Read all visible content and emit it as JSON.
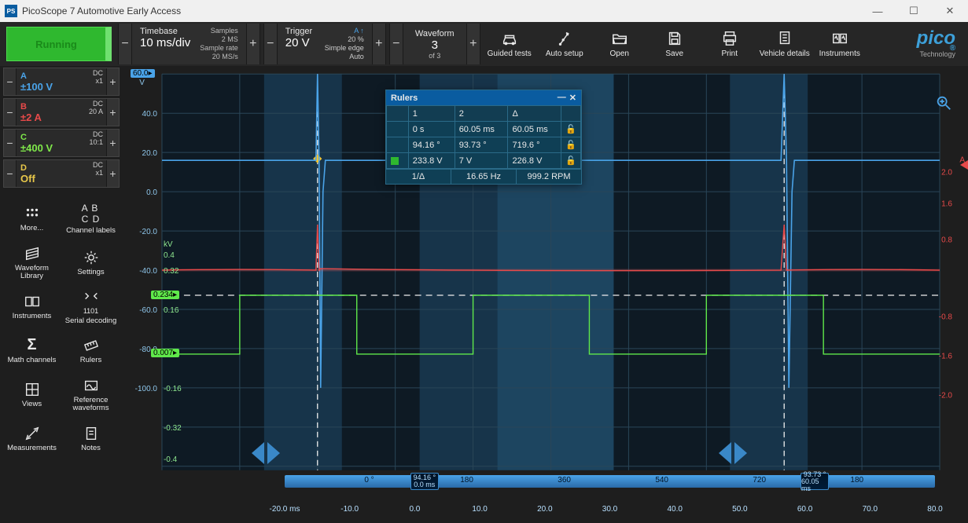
{
  "window": {
    "title": "PicoScope 7 Automotive Early Access"
  },
  "run_button": "Running",
  "timebase": {
    "label": "Timebase",
    "value": "10 ms/div",
    "samples_l": "Samples",
    "samples_v": "2 MS",
    "rate_l": "Sample rate",
    "rate_v": "20 MS/s"
  },
  "trigger": {
    "label": "Trigger",
    "value": "20 V",
    "ch": "A ↑",
    "pct": "20 %",
    "mode": "Simple edge",
    "auto": "Auto"
  },
  "waveform": {
    "label": "Waveform",
    "num": "3",
    "of": "of 3"
  },
  "topicons": {
    "guided": "Guided tests",
    "auto": "Auto setup",
    "open": "Open",
    "save": "Save",
    "print": "Print",
    "vehicle": "Vehicle details",
    "instr": "Instruments"
  },
  "logo": {
    "brand": "pico",
    "sub": "Technology"
  },
  "channels": {
    "A": {
      "label": "A",
      "range": "±100 V",
      "coupling": "DC",
      "probe": "x1"
    },
    "B": {
      "label": "B",
      "range": "±2 A",
      "coupling": "DC",
      "probe": "20 A"
    },
    "C": {
      "label": "C",
      "range": "±400 V",
      "coupling": "DC",
      "probe": "10:1"
    },
    "D": {
      "label": "D",
      "range": "Off",
      "coupling": "DC",
      "probe": "x1"
    }
  },
  "tools": {
    "more": "More...",
    "chlabels": "Channel labels",
    "wflib": "Waveform Library",
    "settings": "Settings",
    "instruments": "Instruments",
    "serial": "Serial decoding",
    "math": "Math channels",
    "rulers": "Rulers",
    "views": "Views",
    "refwf": "Reference waveforms",
    "meas": "Measurements",
    "notes": "Notes"
  },
  "rulers_panel": {
    "title": "Rulers",
    "cols": {
      "c1": "1",
      "c2": "2",
      "cd": "Δ"
    },
    "time": {
      "c1": "0 s",
      "c2": "60.05 ms",
      "cd": "60.05 ms"
    },
    "phase": {
      "c1": "94.16 °",
      "c2": "93.73 °",
      "cd": "719.6 °"
    },
    "volt": {
      "c1": "233.8 V",
      "c2": "7 V",
      "cd": "226.8 V"
    },
    "freq_l": "1/Δ",
    "freq": "16.65 Hz",
    "rpm": "999.2 RPM"
  },
  "ruler_markers": {
    "m1_deg": "94.16 °",
    "m1_t": "0.0 ms",
    "m2_deg": "93.73 °",
    "m2_t": "60.05 ms"
  },
  "rotation_ticks": [
    "0 °",
    "180",
    "360",
    "540",
    "720",
    "180"
  ],
  "xaxis_ticks": [
    "-20.0 ms",
    "-10.0",
    "0.0",
    "10.0",
    "20.0",
    "30.0",
    "40.0",
    "50.0",
    "60.0",
    "70.0",
    "80.0"
  ],
  "yA_ticks": [
    "60.0",
    "40.0",
    "20.0",
    "0.0",
    "-20.0",
    "-40.0",
    "-60.0",
    "-80.0",
    "-100.0"
  ],
  "yA_unit": "V",
  "yC_ticks": [
    "0.4",
    "0.32",
    "0.16",
    "-0.16",
    "-0.32",
    "-0.4"
  ],
  "yC_unit": "kV",
  "yB_ticks": [
    "2.0",
    "1.6",
    "0.8",
    "-0.8",
    "-1.6",
    "-2.0"
  ],
  "yB_unit": "A",
  "tags": {
    "top": "60.0",
    "mid": "0.234",
    "low": "0.007"
  },
  "chart_data": {
    "type": "line",
    "x_range_ms": [
      -20,
      80
    ],
    "x_label": "ms",
    "series": [
      {
        "name": "A",
        "unit": "V",
        "color": "#4aa3e8",
        "segments": [
          {
            "t": [
              -20,
              0
            ],
            "v": 16
          },
          {
            "t": [
              0,
              0.5
            ],
            "v": 60,
            "spike": true
          },
          {
            "t": [
              0.5,
              0.6
            ],
            "v": -80
          },
          {
            "t": [
              0.6,
              58
            ],
            "v": 16
          },
          {
            "t": [
              58,
              59
            ],
            "v": 60,
            "spike": true
          },
          {
            "t": [
              59,
              59.5
            ],
            "v": -80
          },
          {
            "t": [
              59.5,
              80
            ],
            "v": 16
          }
        ]
      },
      {
        "name": "B",
        "unit": "A",
        "color": "#e84a4a",
        "baseline": -0.1,
        "spikes_ms": [
          0,
          58
        ],
        "spike_peak": 0.8
      },
      {
        "name": "C",
        "unit": "kV",
        "color": "#5fe84a",
        "pulses": [
          {
            "start": -10,
            "end": 0,
            "level": 0.007,
            "high": false
          },
          {
            "start": 0,
            "end": 15,
            "level": 0.24
          },
          {
            "start": 15,
            "end": 30,
            "level": 0.007,
            "high": false
          },
          {
            "start": 30,
            "end": 45,
            "level": 0.24
          },
          {
            "start": 45,
            "end": 58,
            "level": 0.007,
            "high": false
          },
          {
            "start": 58,
            "end": 73,
            "level": 0.24
          },
          {
            "start": 73,
            "end": 80,
            "level": 0.007,
            "high": false
          }
        ]
      }
    ],
    "time_rulers_ms": [
      0,
      60.05
    ]
  }
}
